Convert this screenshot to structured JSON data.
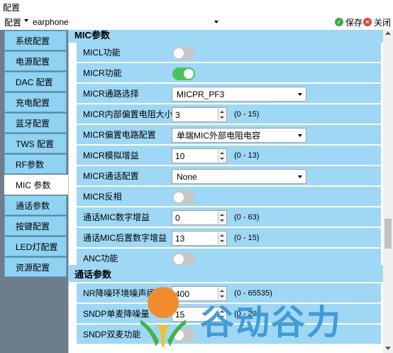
{
  "window": {
    "title": "配置"
  },
  "toolbar": {
    "config_label": "配置",
    "product_value": "earphone",
    "save_label": "保存",
    "close_label": "关闭"
  },
  "colors": {
    "sidebar_bg": "#6e7d8c",
    "item_bg": "#8fd2f1",
    "toggle_on": "#4cc35a",
    "toggle_off": "#c7c7c7",
    "save_icon": "#3aa844",
    "close_icon": "#e2463b",
    "watermark": "#3a96d2"
  },
  "sidebar": {
    "active": "MIC参数",
    "items": [
      "系统配置",
      "电源配置",
      "DAC 配置",
      "充电配置",
      "蓝牙配置",
      "TWS 配置",
      "RF参数",
      "MIC 参数",
      "通话参数",
      "按键配置",
      "LED灯配置",
      "资源配置"
    ]
  },
  "sections": {
    "mic": "MIC参数",
    "call": "通话参数"
  },
  "rows": {
    "micl": {
      "label": "MICL功能",
      "on": false
    },
    "micr": {
      "label": "MICR功能",
      "on": true
    },
    "micr_channel": {
      "label": "MICR通路选择",
      "value": "MICPR_PF3"
    },
    "micr_res": {
      "label": "MICR内部偏置电阻大小",
      "value": "3",
      "range": "(0 - 15)"
    },
    "micr_bias": {
      "label": "MICR偏置电路配置",
      "value": "单端MIC外部电阻电容"
    },
    "micr_gain": {
      "label": "MICR模拟增益",
      "value": "10",
      "range": "(0 - 13)"
    },
    "micr_call": {
      "label": "MICR通话配置",
      "value": "None"
    },
    "micr_invert": {
      "label": "MICR反相",
      "on": false
    },
    "call_digital": {
      "label": "通话MIC数字增益",
      "value": "0",
      "range": "(0 - 63)"
    },
    "call_post": {
      "label": "通话MIC后置数字增益",
      "value": "13",
      "range": "(0 - 15)"
    },
    "anc": {
      "label": "ANC功能",
      "on": false
    },
    "nr_threshold": {
      "label": "NR降噪环境噪声阈值",
      "value": "400",
      "range": "(0 - 65535)"
    },
    "sndp_single": {
      "label": "SNDP单麦降噪量",
      "value": "15",
      "range": "(0 - 20)"
    },
    "sndp_dual": {
      "label": "SNDP双麦功能",
      "on": false
    }
  },
  "watermark": {
    "text": "谷动谷力"
  }
}
